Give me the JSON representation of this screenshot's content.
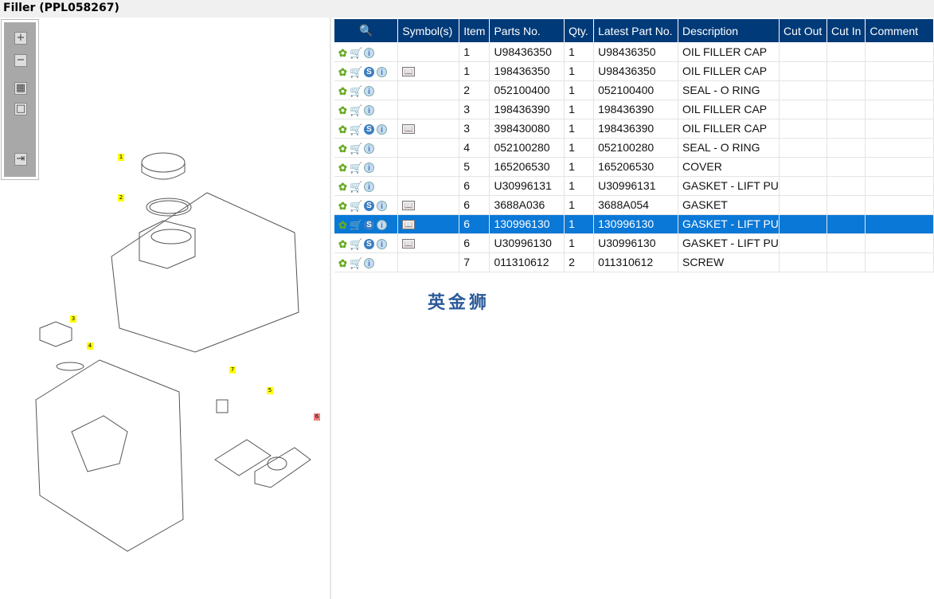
{
  "title": "Filler (PPL058267)",
  "toolbar": {
    "buttons": [
      "zoom-in",
      "zoom-out",
      "fit-all",
      "fit-window",
      "expand-panel"
    ]
  },
  "diagram": {
    "callouts": [
      "1",
      "2",
      "3",
      "4",
      "5",
      "6",
      "7"
    ]
  },
  "table": {
    "headers": [
      "Symbol(s)",
      "Item",
      "Parts No.",
      "Qty.",
      "Latest Part No.",
      "Description",
      "Cut Out",
      "Cut In",
      "Comment"
    ],
    "rows": [
      {
        "s": false,
        "book": false,
        "item": "1",
        "part": "U98436350",
        "qty": "1",
        "latest": "U98436350",
        "desc": "OIL FILLER CAP"
      },
      {
        "s": true,
        "book": true,
        "item": "1",
        "part": "198436350",
        "qty": "1",
        "latest": "U98436350",
        "desc": "OIL FILLER CAP"
      },
      {
        "s": false,
        "book": false,
        "item": "2",
        "part": "052100400",
        "qty": "1",
        "latest": "052100400",
        "desc": "SEAL - O RING"
      },
      {
        "s": false,
        "book": false,
        "item": "3",
        "part": "198436390",
        "qty": "1",
        "latest": "198436390",
        "desc": "OIL FILLER CAP"
      },
      {
        "s": true,
        "book": true,
        "item": "3",
        "part": "398430080",
        "qty": "1",
        "latest": "198436390",
        "desc": "OIL FILLER CAP"
      },
      {
        "s": false,
        "book": false,
        "item": "4",
        "part": "052100280",
        "qty": "1",
        "latest": "052100280",
        "desc": "SEAL - O RING"
      },
      {
        "s": false,
        "book": false,
        "item": "5",
        "part": "165206530",
        "qty": "1",
        "latest": "165206530",
        "desc": "COVER"
      },
      {
        "s": false,
        "book": false,
        "item": "6",
        "part": "U30996131",
        "qty": "1",
        "latest": "U30996131",
        "desc": "GASKET - LIFT PUM"
      },
      {
        "s": true,
        "book": true,
        "item": "6",
        "part": "3688A036",
        "qty": "1",
        "latest": "3688A054",
        "desc": "GASKET"
      },
      {
        "s": true,
        "book": true,
        "item": "6",
        "part": "130996130",
        "qty": "1",
        "latest": "130996130",
        "desc": "GASKET - LIFT PUM",
        "selected": true
      },
      {
        "s": true,
        "book": true,
        "item": "6",
        "part": "U30996130",
        "qty": "1",
        "latest": "U30996130",
        "desc": "GASKET - LIFT PUM"
      },
      {
        "s": false,
        "book": false,
        "item": "7",
        "part": "011310612",
        "qty": "2",
        "latest": "011310612",
        "desc": "SCREW"
      }
    ]
  },
  "watermark": "英金狮"
}
